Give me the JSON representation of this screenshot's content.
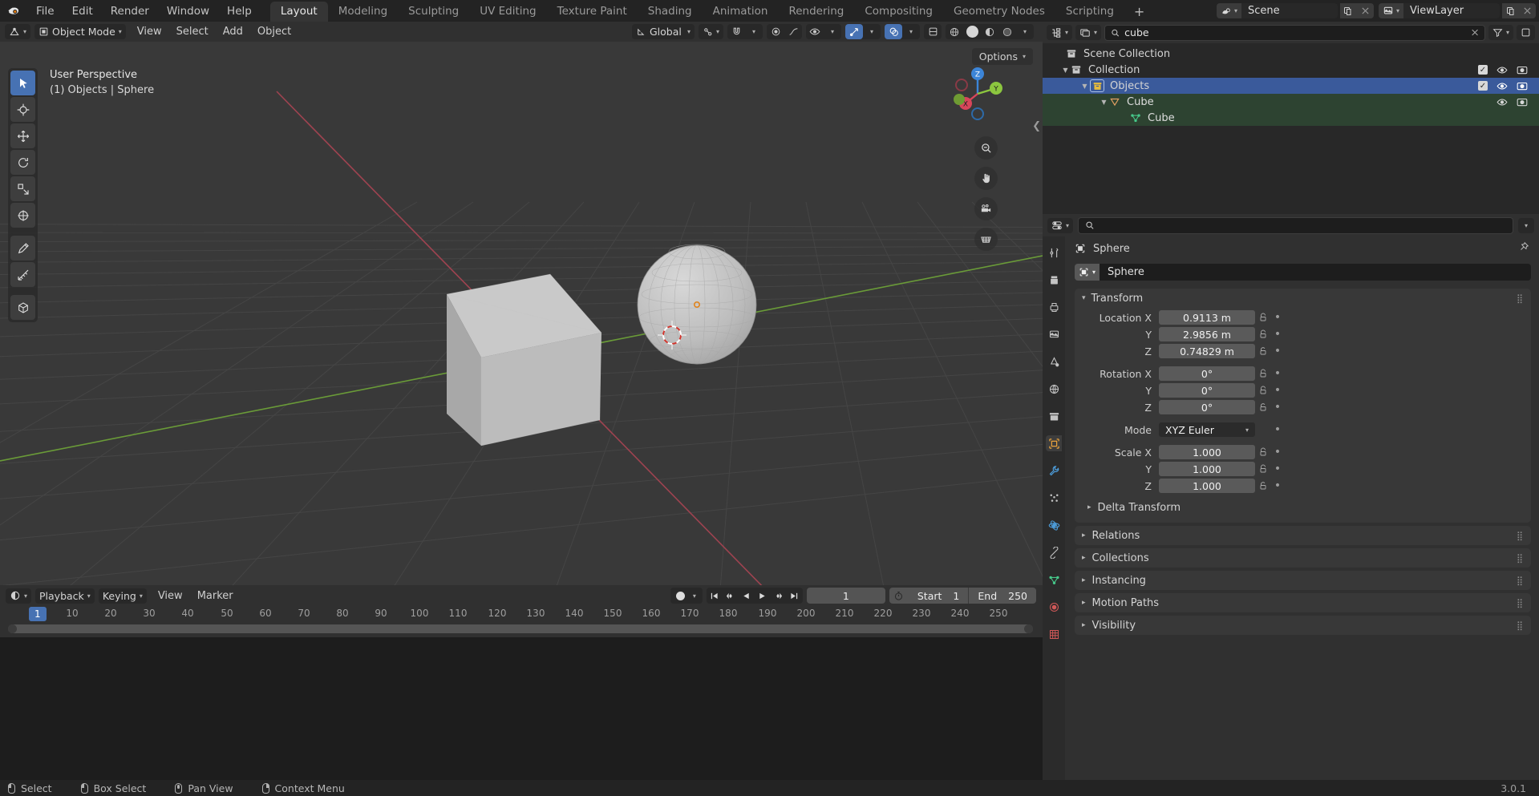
{
  "app": {
    "version": "3.0.1"
  },
  "topbar": {
    "logo_icon": "blender-logo-icon",
    "menus": [
      "File",
      "Edit",
      "Render",
      "Window",
      "Help"
    ],
    "workspaces": [
      {
        "label": "Layout",
        "active": true
      },
      {
        "label": "Modeling",
        "active": false
      },
      {
        "label": "Sculpting",
        "active": false
      },
      {
        "label": "UV Editing",
        "active": false
      },
      {
        "label": "Texture Paint",
        "active": false
      },
      {
        "label": "Shading",
        "active": false
      },
      {
        "label": "Animation",
        "active": false
      },
      {
        "label": "Rendering",
        "active": false
      },
      {
        "label": "Compositing",
        "active": false
      },
      {
        "label": "Geometry Nodes",
        "active": false
      },
      {
        "label": "Scripting",
        "active": false
      }
    ],
    "add_workspace_label": "+",
    "scene_name": "Scene",
    "viewlayer_name": "ViewLayer",
    "scene_icon": "scene-icon",
    "viewlayer_icon": "viewlayer-icon",
    "copy_icon": "duplicate-icon",
    "close_icon": "close-icon"
  },
  "viewport_header": {
    "editor_type_icon": "editor-type-icon",
    "mode": "Object Mode",
    "menus": [
      "View",
      "Select",
      "Add",
      "Object"
    ],
    "transform_orientation": "Global",
    "snap_icon": "magnet-icon",
    "proportional_icon": "proportional-edit-icon",
    "options_label": "Options"
  },
  "viewport": {
    "perspective_label": "User Perspective",
    "status_label": "(1) Objects | Sphere",
    "gizmo_axes": [
      "Z",
      "Y",
      "X"
    ],
    "tools": [
      {
        "name": "tweak-tool",
        "active": true
      },
      {
        "name": "cursor-tool",
        "active": false
      },
      {
        "name": "move-tool",
        "active": false
      },
      {
        "name": "rotate-tool",
        "active": false
      },
      {
        "name": "scale-tool",
        "active": false
      },
      {
        "name": "transform-tool",
        "active": false
      },
      {
        "name": "annotate-tool",
        "active": false
      },
      {
        "name": "measure-tool",
        "active": false
      },
      {
        "name": "add-cube-tool",
        "active": false
      }
    ],
    "nav_icons": [
      "zoom-icon",
      "pan-icon",
      "camera-view-icon",
      "toggle-ortho-icon"
    ]
  },
  "timeline": {
    "editor_icon": "timeline-editor-icon",
    "menus": [
      "Playback",
      "Keying",
      "View",
      "Marker"
    ],
    "record_icon": "auto-keying-icon",
    "transport": [
      "jump-to-start-icon",
      "jump-to-prev-keyframe-icon",
      "play-reverse-icon",
      "play-icon",
      "jump-to-next-keyframe-icon",
      "jump-to-end-icon"
    ],
    "current_frame": "1",
    "frame_icon": "stopwatch-icon",
    "start_label": "Start",
    "start_value": "1",
    "end_label": "End",
    "end_value": "250",
    "ticks": [
      "10",
      "20",
      "30",
      "40",
      "50",
      "60",
      "70",
      "80",
      "90",
      "100",
      "110",
      "120",
      "130",
      "140",
      "150",
      "160",
      "170",
      "180",
      "190",
      "200",
      "210",
      "220",
      "230",
      "240",
      "250"
    ],
    "playhead_label": "1"
  },
  "outliner": {
    "display_mode_icon": "outliner-display-mode-icon",
    "filter_id_icon": "id-type-icon",
    "search_value": "cube",
    "search_placeholder": "",
    "search_icon": "search-icon",
    "clear_icon": "close-icon",
    "filter_icon": "filter-icon",
    "rows": [
      {
        "label": "Scene Collection",
        "icon": "collection-icon",
        "indent": 0,
        "expander": "",
        "state": "none",
        "checkbox": false,
        "eye": false,
        "camera": false
      },
      {
        "label": "Collection",
        "icon": "collection-icon",
        "indent": 1,
        "expander": "down",
        "state": "none",
        "checkbox": true,
        "eye": true,
        "camera": true
      },
      {
        "label": "Objects",
        "icon": "collection-color-icon",
        "indent": 2,
        "expander": "down",
        "state": "selected",
        "checkbox": true,
        "eye": true,
        "camera": true
      },
      {
        "label": "Cube",
        "icon": "mesh-object-icon",
        "indent": 3,
        "expander": "down",
        "state": "active",
        "checkbox": false,
        "eye": true,
        "camera": true
      },
      {
        "label": "Cube",
        "icon": "mesh-data-icon",
        "indent": 4,
        "expander": "",
        "state": "active",
        "checkbox": false,
        "eye": false,
        "camera": false
      }
    ]
  },
  "properties": {
    "editor_icon": "properties-editor-icon",
    "search_value": "",
    "search_placeholder": "",
    "search_icon": "search-icon",
    "chevron_icon": "chevron-down-icon",
    "tabs": [
      {
        "name": "tool-tab",
        "icon": "tool-icon",
        "active": false
      },
      {
        "name": "render-tab",
        "icon": "render-icon",
        "active": false
      },
      {
        "name": "output-tab",
        "icon": "printer-icon",
        "active": false
      },
      {
        "name": "view-layer-tab",
        "icon": "images-icon",
        "active": false
      },
      {
        "name": "scene-tab",
        "icon": "scene-cone-icon",
        "active": false
      },
      {
        "name": "world-tab",
        "icon": "world-icon",
        "active": false
      },
      {
        "name": "collection-tab",
        "icon": "collection-props-icon",
        "active": false
      },
      {
        "name": "object-tab",
        "icon": "object-icon",
        "active": true
      },
      {
        "name": "modifiers-tab",
        "icon": "wrench-icon",
        "active": false
      },
      {
        "name": "particles-tab",
        "icon": "particles-icon",
        "active": false
      },
      {
        "name": "physics-tab",
        "icon": "physics-icon",
        "active": false
      },
      {
        "name": "constraints-tab",
        "icon": "constraints-icon",
        "active": false
      },
      {
        "name": "data-tab",
        "icon": "mesh-data-icon",
        "active": false
      },
      {
        "name": "material-tab",
        "icon": "material-icon",
        "active": false
      },
      {
        "name": "texture-tab",
        "icon": "texture-icon",
        "active": false
      }
    ],
    "breadcrumb_icon": "object-icon",
    "breadcrumb_label": "Sphere",
    "pin_icon": "pin-icon",
    "object_name": "Sphere",
    "object_id_icon": "object-icon",
    "transform_panel": {
      "title": "Transform",
      "fields": [
        {
          "label": "Location X",
          "value": "0.9113 m",
          "lock": "locked-alt",
          "group": 0
        },
        {
          "label": "Y",
          "value": "2.9856 m",
          "lock": "locked-alt",
          "group": 0
        },
        {
          "label": "Z",
          "value": "0.74829 m",
          "lock": "unlocked",
          "group": 0
        },
        {
          "label": "Rotation X",
          "value": "0°",
          "lock": "locked-alt",
          "group": 1
        },
        {
          "label": "Y",
          "value": "0°",
          "lock": "locked-alt",
          "group": 1
        },
        {
          "label": "Z",
          "value": "0°",
          "lock": "unlocked",
          "group": 1
        }
      ],
      "mode_label": "Mode",
      "mode_value": "XYZ Euler",
      "scale_fields": [
        {
          "label": "Scale X",
          "value": "1.000",
          "lock": "locked-alt"
        },
        {
          "label": "Y",
          "value": "1.000",
          "lock": "locked-alt"
        },
        {
          "label": "Z",
          "value": "1.000",
          "lock": "unlocked"
        }
      ],
      "delta_transform_label": "Delta Transform"
    },
    "collapsed_panels": [
      {
        "label": "Relations"
      },
      {
        "label": "Collections"
      },
      {
        "label": "Instancing"
      },
      {
        "label": "Motion Paths"
      },
      {
        "label": "Visibility"
      }
    ]
  },
  "statusbar": {
    "items": [
      {
        "label": "Select",
        "mouse": "left"
      },
      {
        "label": "Box Select",
        "mouse": "left-drag"
      },
      {
        "label": "Pan View",
        "mouse": "middle"
      },
      {
        "label": "Context Menu",
        "mouse": "right"
      }
    ],
    "version": "3.0.1"
  }
}
